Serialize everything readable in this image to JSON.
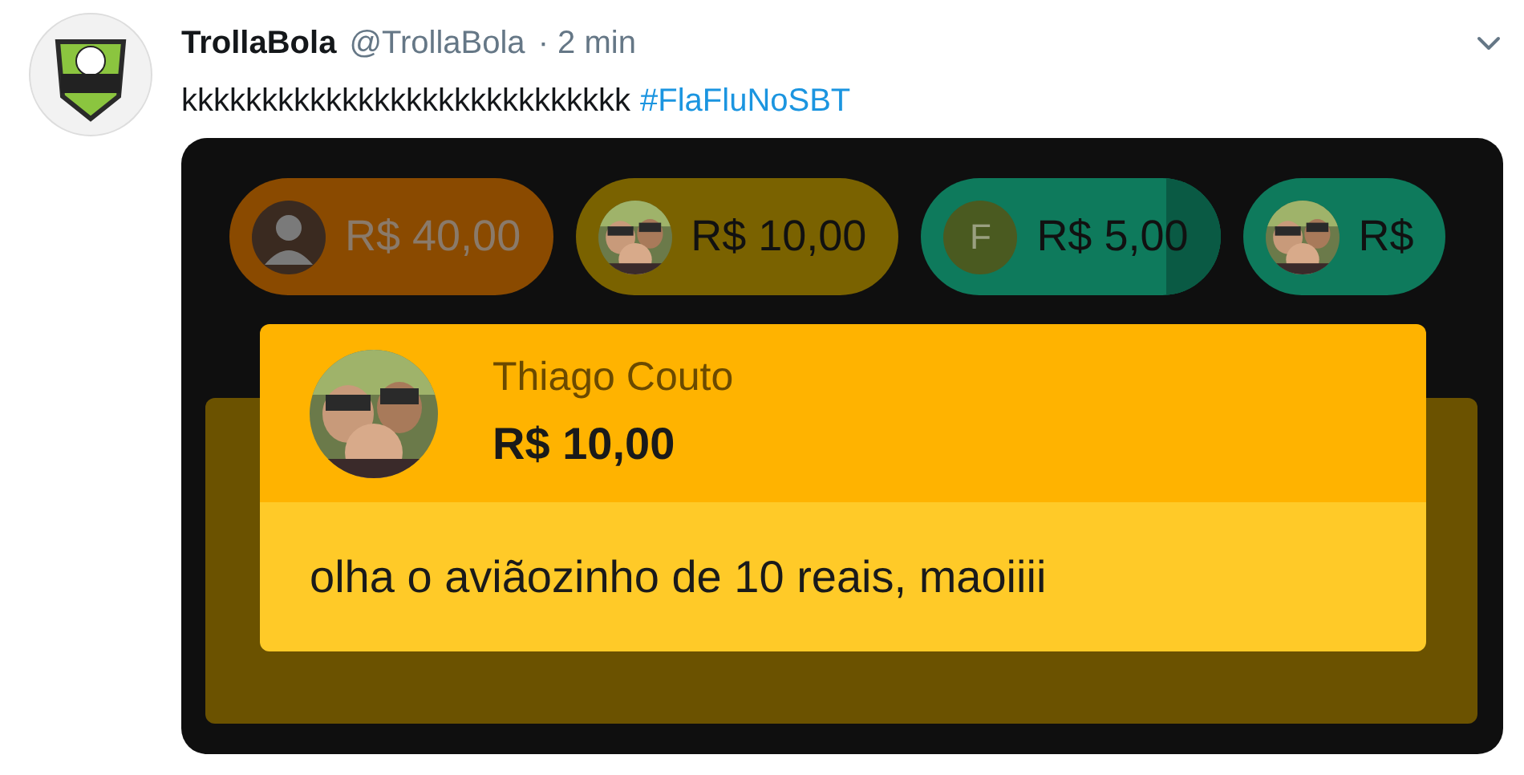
{
  "tweet": {
    "author": "TrollaBola",
    "handle": "@TrollaBola",
    "time": "· 2 min",
    "text": "kkkkkkkkkkkkkkkkkkkkkkkkkkkk",
    "hashtag": "#FlaFluNoSBT"
  },
  "chips": [
    {
      "kind": "generic",
      "amount": "R$ 40,00",
      "color": "#8a4a00"
    },
    {
      "amount": "R$ 10,00",
      "color": "#7a6200"
    },
    {
      "kind": "letter",
      "letter": "F",
      "amount": "R$ 5,00",
      "color": "#0e7a5c",
      "striped": true
    },
    {
      "amount": "R$",
      "color": "#0e7a5c"
    }
  ],
  "super_chat": {
    "name": "Thiago Couto",
    "amount": "R$ 10,00",
    "message": "olha o aviãozinho de 10 reais, maoiiii"
  }
}
